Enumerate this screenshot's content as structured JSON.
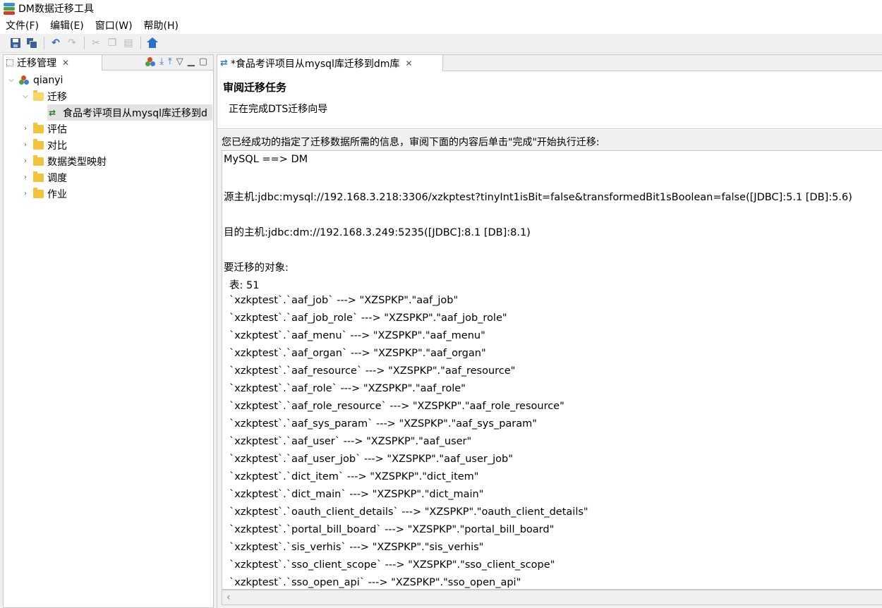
{
  "window": {
    "title": "DM数据迁移工具"
  },
  "menu": [
    "文件(F)",
    "编辑(E)",
    "窗口(W)",
    "帮助(H)"
  ],
  "left_panel": {
    "tab_label": "迁移管理",
    "tree": {
      "root": "qianyi",
      "migrate_folder": "迁移",
      "migration_item": "食品考评项目从mysql库迁移到d",
      "folders": [
        "评估",
        "对比",
        "数据类型映射",
        "调度",
        "作业"
      ]
    }
  },
  "editor": {
    "tab_label": "*食品考评项目从mysql库迁移到dm库",
    "wizard_title": "审阅迁移任务",
    "wizard_subtitle": "正在完成DTS迁移向导",
    "intro": "您已经成功的指定了迁移数据所需的信息，审阅下面的内容后单击\"完成\"开始执行迁移:",
    "summary": {
      "mode": "MySQL ==> DM",
      "source": "源主机:jdbc:mysql://192.168.3.218:3306/xzkptest?tinyInt1isBit=false&transformedBit1sBoolean=false([JDBC]:5.1 [DB]:5.6)",
      "target": "目的主机:jdbc:dm://192.168.3.249:5235([JDBC]:8.1 [DB]:8.1)",
      "objects_label": "要迁移的对象:",
      "table_count": "表: 51",
      "mappings": [
        "`xzkptest`.`aaf_job` ---> \"XZSPKP\".\"aaf_job\"",
        "`xzkptest`.`aaf_job_role` ---> \"XZSPKP\".\"aaf_job_role\"",
        "`xzkptest`.`aaf_menu` ---> \"XZSPKP\".\"aaf_menu\"",
        "`xzkptest`.`aaf_organ` ---> \"XZSPKP\".\"aaf_organ\"",
        "`xzkptest`.`aaf_resource` ---> \"XZSPKP\".\"aaf_resource\"",
        "`xzkptest`.`aaf_role` ---> \"XZSPKP\".\"aaf_role\"",
        "`xzkptest`.`aaf_role_resource` ---> \"XZSPKP\".\"aaf_role_resource\"",
        "`xzkptest`.`aaf_sys_param` ---> \"XZSPKP\".\"aaf_sys_param\"",
        "`xzkptest`.`aaf_user` ---> \"XZSPKP\".\"aaf_user\"",
        "`xzkptest`.`aaf_user_job` ---> \"XZSPKP\".\"aaf_user_job\"",
        "`xzkptest`.`dict_item` ---> \"XZSPKP\".\"dict_item\"",
        "`xzkptest`.`dict_main` ---> \"XZSPKP\".\"dict_main\"",
        "`xzkptest`.`oauth_client_details` ---> \"XZSPKP\".\"oauth_client_details\"",
        "`xzkptest`.`portal_bill_board` ---> \"XZSPKP\".\"portal_bill_board\"",
        "`xzkptest`.`sis_verhis` ---> \"XZSPKP\".\"sis_verhis\"",
        "`xzkptest`.`sso_client_scope` ---> \"XZSPKP\".\"sso_client_scope\"",
        "`xzkptest`.`sso_open_api` ---> \"XZSPKP\".\"sso_open_api\""
      ]
    }
  }
}
